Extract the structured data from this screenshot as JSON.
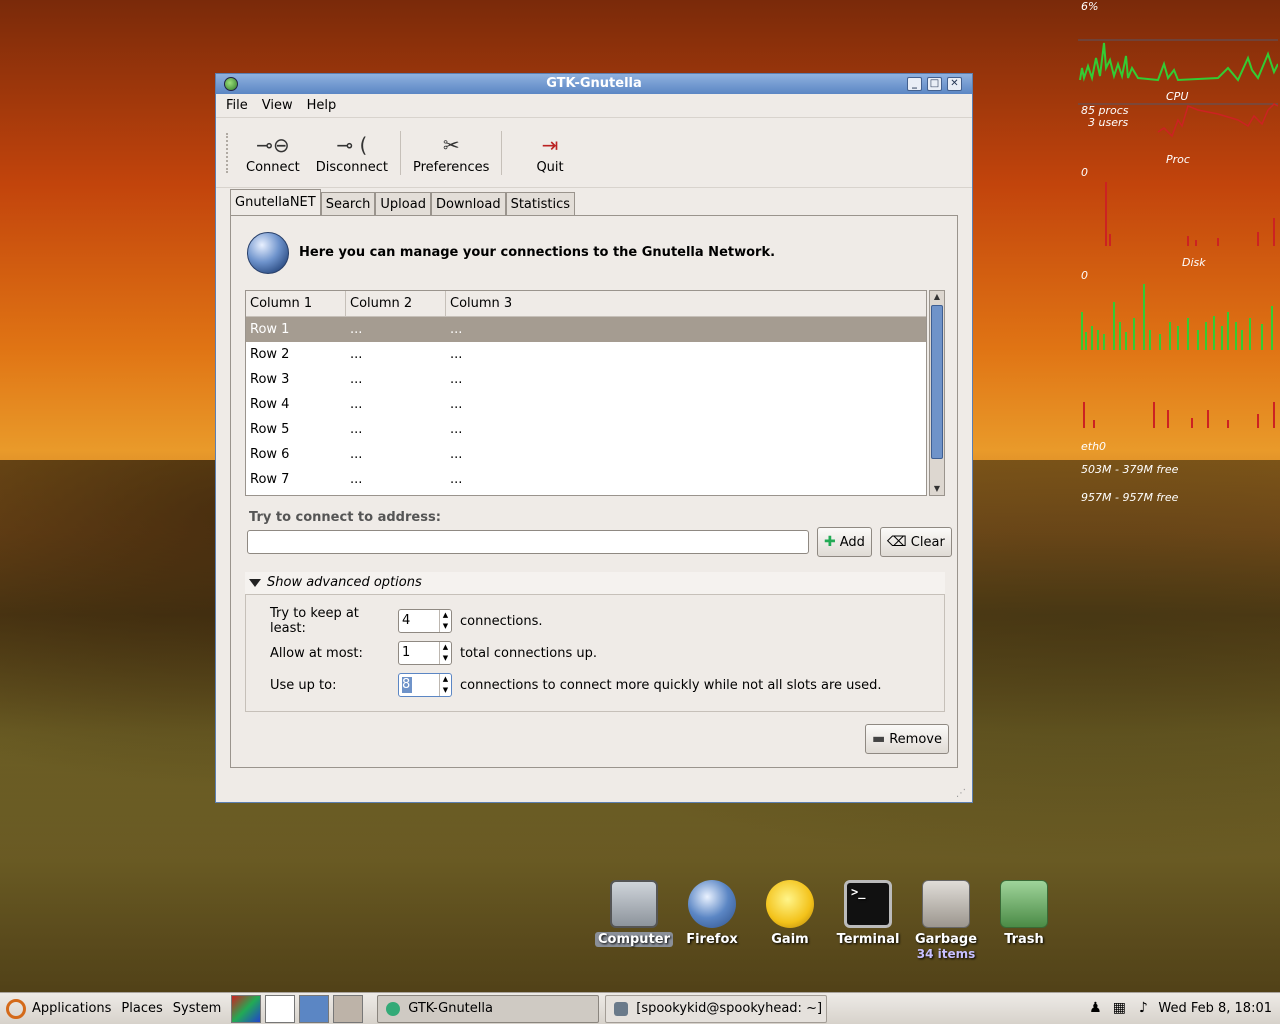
{
  "window": {
    "title": "GTK-Gnutella",
    "menu": [
      "File",
      "View",
      "Help"
    ],
    "toolbar": [
      {
        "label": "Connect",
        "icon": "plug-connect-icon",
        "glyph": "⊸⊖"
      },
      {
        "label": "Disconnect",
        "icon": "plug-disconnect-icon",
        "glyph": "⊸ ("
      },
      {
        "label": "Preferences",
        "icon": "tools-icon",
        "glyph": "✂"
      },
      {
        "label": "Quit",
        "icon": "exit-icon",
        "glyph": "⇥"
      }
    ],
    "tabs": [
      "GnutellaNET",
      "Search",
      "Upload",
      "Download",
      "Statistics"
    ],
    "intro": "Here you can manage your connections to the Gnutella Network.",
    "columns": [
      "Column 1",
      "Column 2",
      "Column 3"
    ],
    "rows": [
      [
        "Row 1",
        "...",
        "..."
      ],
      [
        "Row 2",
        "...",
        "..."
      ],
      [
        "Row 3",
        "...",
        "..."
      ],
      [
        "Row 4",
        "...",
        "..."
      ],
      [
        "Row 5",
        "...",
        "..."
      ],
      [
        "Row 6",
        "...",
        "..."
      ],
      [
        "Row 7",
        "...",
        "..."
      ]
    ],
    "connect_label": "Try to connect to address:",
    "address_value": "",
    "add_label": "Add",
    "clear_label": "Clear",
    "advanced_label": "Show advanced options",
    "keep_label": "Try to keep at least:",
    "keep_value": "4",
    "keep_suffix": "connections.",
    "allow_label": "Allow at most:",
    "allow_value": "1",
    "allow_suffix": "total connections up.",
    "useup_label": "Use up to:",
    "useup_value": "8",
    "useup_suffix": "connections to connect more quickly while not all slots are used.",
    "remove_label": "Remove"
  },
  "conky": {
    "cpu_pct": "6%",
    "cpu": "CPU",
    "procs": "85 procs",
    "users": "3 users",
    "proc": "Proc",
    "zero1": "0",
    "disk": "Disk",
    "zero2": "0",
    "net": "eth0",
    "mem": "503M - 379M free",
    "swap": "957M - 957M free"
  },
  "desktop_icons": [
    {
      "name": "Computer",
      "icon": "computer-icon",
      "sub": ""
    },
    {
      "name": "Firefox",
      "icon": "firefox-icon",
      "sub": ""
    },
    {
      "name": "Gaim",
      "icon": "gaim-icon",
      "sub": ""
    },
    {
      "name": "Terminal",
      "icon": "terminal-icon",
      "sub": ""
    },
    {
      "name": "Garbage",
      "icon": "folder-icon",
      "sub": "34 items"
    },
    {
      "name": "Trash",
      "icon": "trash-icon",
      "sub": ""
    }
  ],
  "panel": {
    "menus": [
      "Applications",
      "Places",
      "System"
    ],
    "tasks": [
      "GTK-Gnutella",
      "[spookykid@spookyhead: ~]"
    ],
    "clock": "Wed Feb 8, 18:01"
  },
  "colors": {
    "titlebar": "#5b86c4",
    "selection": "#a59c91",
    "accent": "#6f93c9"
  }
}
